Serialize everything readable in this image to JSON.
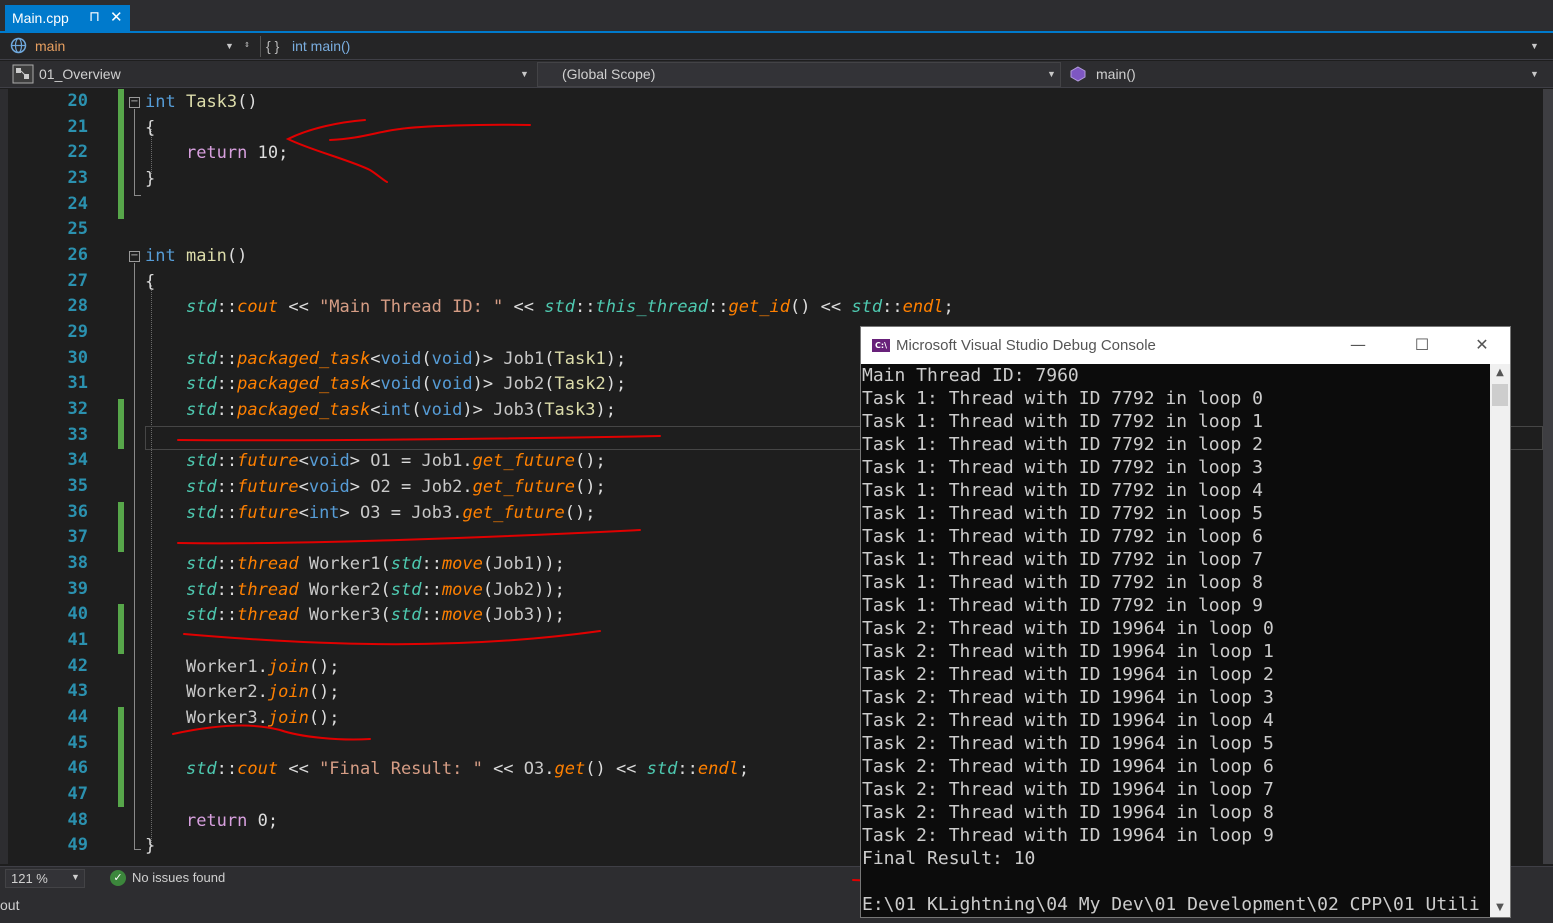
{
  "tab": {
    "title": "Main.cpp",
    "pin_icon": "⊓",
    "close_icon": "✕"
  },
  "nav1": {
    "project": "main",
    "member": "int main()"
  },
  "nav2": {
    "project": "01_Overview",
    "scope": "(Global Scope)",
    "function": "main()"
  },
  "editor": {
    "line_numbers": [
      "20",
      "21",
      "22",
      "23",
      "24",
      "25",
      "26",
      "27",
      "28",
      "29",
      "30",
      "31",
      "32",
      "33",
      "34",
      "35",
      "36",
      "37",
      "38",
      "39",
      "40",
      "41",
      "42",
      "43",
      "44",
      "45",
      "46",
      "47",
      "48",
      "49"
    ],
    "strings": {
      "main_thread": "\"Main Thread ID: \"",
      "final_result": "\"Final Result: \""
    },
    "numbers": {
      "ten": "10",
      "zero": "0"
    }
  },
  "status": {
    "zoom": "121 %",
    "issues": "No issues found",
    "bottom_left": "out"
  },
  "console": {
    "title": "Microsoft Visual Studio Debug Console",
    "icon_text": "C:\\",
    "lines": [
      "Main Thread ID: 7960",
      "Task 1: Thread with ID 7792 in loop 0",
      "Task 1: Thread with ID 7792 in loop 1",
      "Task 1: Thread with ID 7792 in loop 2",
      "Task 1: Thread with ID 7792 in loop 3",
      "Task 1: Thread with ID 7792 in loop 4",
      "Task 1: Thread with ID 7792 in loop 5",
      "Task 1: Thread with ID 7792 in loop 6",
      "Task 1: Thread with ID 7792 in loop 7",
      "Task 1: Thread with ID 7792 in loop 8",
      "Task 1: Thread with ID 7792 in loop 9",
      "Task 2: Thread with ID 19964 in loop 0",
      "Task 2: Thread with ID 19964 in loop 1",
      "Task 2: Thread with ID 19964 in loop 2",
      "Task 2: Thread with ID 19964 in loop 3",
      "Task 2: Thread with ID 19964 in loop 4",
      "Task 2: Thread with ID 19964 in loop 5",
      "Task 2: Thread with ID 19964 in loop 6",
      "Task 2: Thread with ID 19964 in loop 7",
      "Task 2: Thread with ID 19964 in loop 8",
      "Task 2: Thread with ID 19964 in loop 9",
      "Final Result: 10",
      "",
      "E:\\01 KLightning\\04 My Dev\\01 Development\\02 CPP\\01 Utili"
    ]
  },
  "colors": {
    "accent": "#007acc",
    "keyword": "#569cd6",
    "function": "#dcdcaa",
    "string": "#d69d85",
    "type": "#4ec9b0",
    "annotation": "#e00000"
  }
}
